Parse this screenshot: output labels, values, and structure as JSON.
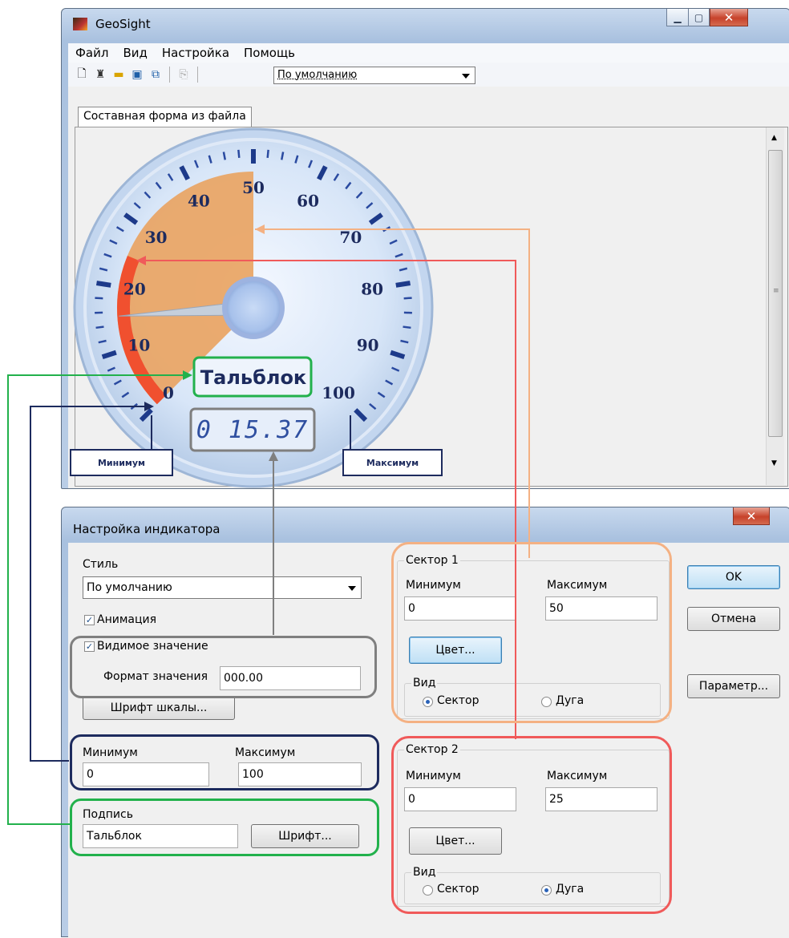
{
  "main_window": {
    "title": "GeoSight",
    "menu": [
      "Файл",
      "Вид",
      "Настройка",
      "Помощь"
    ],
    "style_combo_value": "По умолчанию",
    "tab_label": "Составная форма из файла",
    "toolbar_icons": [
      "new-file-icon",
      "beacon-icon",
      "open-folder-icon",
      "save-icon",
      "save-all-icon",
      "copy-icon"
    ]
  },
  "gauge": {
    "tick_labels": [
      "0",
      "10",
      "20",
      "30",
      "40",
      "50",
      "60",
      "70",
      "80",
      "90",
      "100"
    ],
    "caption": "Тальблок",
    "digital_value": "0 15.37",
    "needle_value": 15.37,
    "min": 0,
    "max": 100,
    "sector1": {
      "min": 0,
      "max": 50,
      "color": "#e9a463"
    },
    "sector2": {
      "min": 0,
      "max": 25,
      "color": "#f0502f"
    }
  },
  "callouts": {
    "min_label": "Минимум",
    "max_label": "Максимум"
  },
  "dialog": {
    "title": "Настройка индикатора",
    "style_label": "Стиль",
    "style_value": "По умолчанию",
    "animation_label": "Анимация",
    "animation_checked": true,
    "visible_value_label": "Видимое значение",
    "visible_value_checked": true,
    "format_label": "Формат значения",
    "format_value": "000.00",
    "scale_font_button": "Шрифт шкалы...",
    "min_label": "Минимум",
    "max_label": "Максимум",
    "min_value": "0",
    "max_value": "100",
    "caption_label": "Подпись",
    "caption_value": "Тальблок",
    "font_button": "Шрифт...",
    "ok_button": "OK",
    "cancel_button": "Отмена",
    "param_button": "Параметр...",
    "sector1": {
      "title": "Сектор 1",
      "min_label": "Минимум",
      "max_label": "Максимум",
      "min_value": "0",
      "max_value": "50",
      "color_button": "Цвет...",
      "view_label": "Вид",
      "sector_option": "Сектор",
      "arc_option": "Дуга",
      "selected": "Сектор"
    },
    "sector2": {
      "title": "Сектор 2",
      "min_label": "Минимум",
      "max_label": "Максимум",
      "min_value": "0",
      "max_value": "25",
      "color_button": "Цвет...",
      "view_label": "Вид",
      "sector_option": "Сектор",
      "arc_option": "Дуга",
      "selected": "Дуга"
    }
  },
  "colors": {
    "navy": "#1d2b5e",
    "green": "#22b14c",
    "gray": "#7f7f7f",
    "orange": "#f4b183",
    "red": "#f05a5a"
  }
}
